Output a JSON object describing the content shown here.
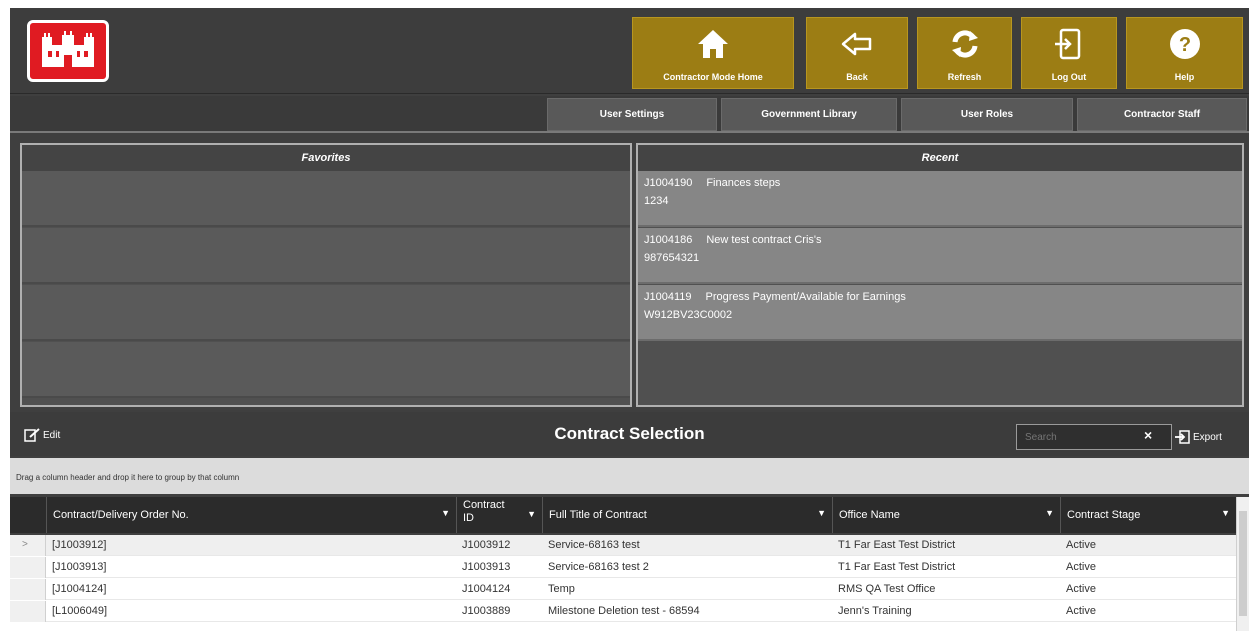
{
  "nav": {
    "buttons": [
      {
        "label": "Contractor Mode Home",
        "icon": "home-icon"
      },
      {
        "label": "Back",
        "icon": "back-arrow-icon"
      },
      {
        "label": "Refresh",
        "icon": "refresh-icon"
      },
      {
        "label": "Log Out",
        "icon": "logout-icon"
      },
      {
        "label": "Help",
        "icon": "help-icon"
      }
    ],
    "accent_color": "#9c7d14"
  },
  "tabs": [
    "User Settings",
    "Government Library",
    "User Roles",
    "Contractor Staff"
  ],
  "favorites": {
    "title": "Favorites"
  },
  "recent": {
    "title": "Recent",
    "items": [
      {
        "id": "J1004190",
        "title": "Finances steps",
        "number": "1234"
      },
      {
        "id": "J1004186",
        "title": "New test contract Cris's",
        "number": "987654321"
      },
      {
        "id": "J1004119",
        "title": "Progress Payment/Available for Earnings",
        "number": "W912BV23C0002"
      }
    ]
  },
  "selection": {
    "title": "Contract Selection",
    "edit_label": "Edit",
    "search_placeholder": "Search",
    "clear_label": "×",
    "export_label": "Export"
  },
  "grid": {
    "group_hint": "Drag a column header and drop it here to group by that column",
    "columns": [
      "Contract/Delivery Order No.",
      "Contract ID",
      "Full Title of Contract",
      "Office Name",
      "Contract Stage"
    ],
    "rows": [
      [
        "[J1003912]",
        "J1003912",
        "Service-68163 test",
        "T1 Far East Test District",
        "Active"
      ],
      [
        "[J1003913]",
        "J1003913",
        "Service-68163 test 2",
        "T1 Far East Test District",
        "Active"
      ],
      [
        "[J1004124]",
        "J1004124",
        "Temp",
        "RMS QA Test Office",
        "Active"
      ],
      [
        "[L1006049]",
        "J1003889",
        "Milestone Deletion test - 68594",
        "Jenn's Training",
        "Active"
      ]
    ],
    "selected_row_marker": ">"
  }
}
